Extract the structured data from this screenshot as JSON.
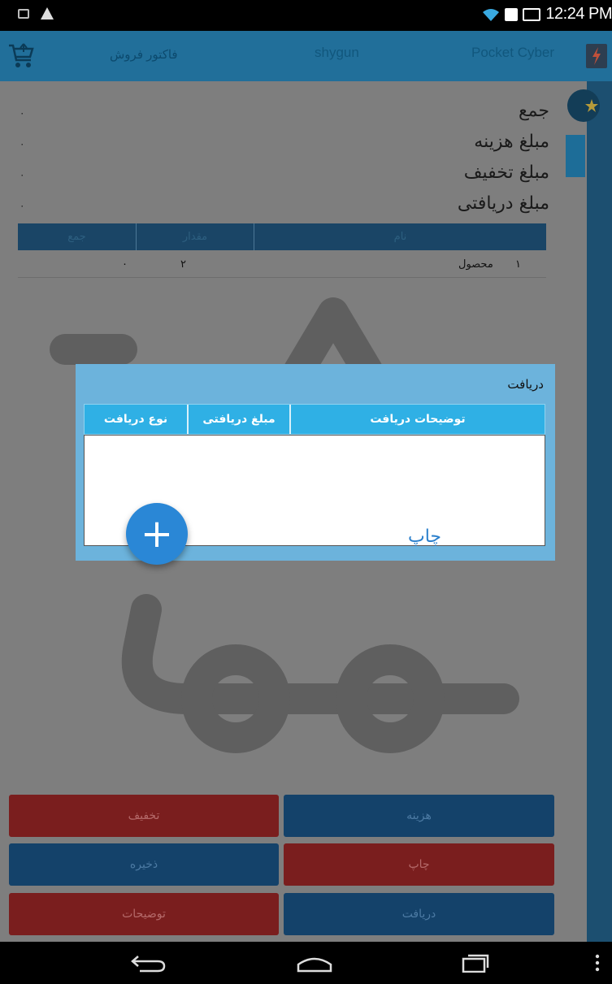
{
  "status_bar": {
    "time": "12:24 PM"
  },
  "app_bar": {
    "title": "فاکتور فروش",
    "user": "shygun",
    "brand": "Pocket Cyber"
  },
  "summary": [
    {
      "label": "جمع",
      "value": "۰"
    },
    {
      "label": "مبلغ هزینه",
      "value": "۰"
    },
    {
      "label": "مبلغ تخفیف",
      "value": "۰"
    },
    {
      "label": "مبلغ دریافتی",
      "value": "۰"
    }
  ],
  "items_table": {
    "columns": [
      "جمع",
      "مقدار",
      "نام"
    ],
    "rows": [
      {
        "index": "۱",
        "name": "محصول",
        "qty": "۲",
        "total": "۰"
      }
    ]
  },
  "dialog": {
    "title": "دریافت",
    "columns": [
      "نوع دریافت",
      "مبلغ دریافتی",
      "توضیحات دریافت"
    ],
    "print_label": "چاپ",
    "add_icon": "plus-icon"
  },
  "buttons": {
    "discount": "تخفیف",
    "cost": "هزینه",
    "save": "ذخیره",
    "print": "چاپ",
    "notes": "توضیحات",
    "receive": "دریافت"
  },
  "colors": {
    "dialog_bg": "#6cb3dc",
    "dialog_header": "#2fb0e5",
    "fab": "#2a87d6",
    "button_red": "#7a1e1e",
    "button_blue": "#14426a",
    "app_bar": "#216f9a"
  }
}
